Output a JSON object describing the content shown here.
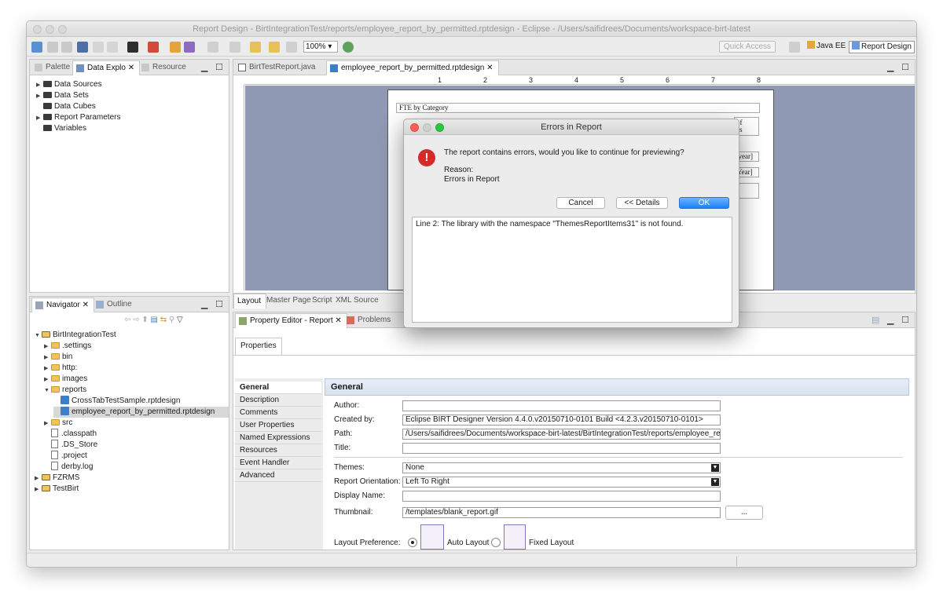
{
  "window": {
    "title": "Report Design - BirtIntegrationTest/reports/employee_report_by_permitted.rptdesign - Eclipse - /Users/saifidrees/Documents/workspace-birt-latest"
  },
  "toolbar": {
    "zoom": "100%",
    "quick_access": "Quick Access",
    "perspective_java": "Java EE",
    "perspective_report": "Report Design"
  },
  "left_top": {
    "tabs": [
      "Palette",
      "Data Explo",
      "Resource"
    ],
    "items": [
      "Data Sources",
      "Data Sets",
      "Data Cubes",
      "Report Parameters",
      "Variables"
    ]
  },
  "navigator": {
    "tabs": [
      "Navigator",
      "Outline"
    ],
    "tree": [
      {
        "label": "BirtIntegrationTest",
        "indent": 0,
        "kind": "proj",
        "open": true
      },
      {
        "label": ".settings",
        "indent": 1,
        "kind": "folder"
      },
      {
        "label": "bin",
        "indent": 1,
        "kind": "folder"
      },
      {
        "label": "http:",
        "indent": 1,
        "kind": "folder"
      },
      {
        "label": "images",
        "indent": 1,
        "kind": "folder"
      },
      {
        "label": "reports",
        "indent": 1,
        "kind": "folder",
        "open": true
      },
      {
        "label": "CrossTabTestSample.rptdesign",
        "indent": 2,
        "kind": "rpt"
      },
      {
        "label": "employee_report_by_permitted.rptdesign",
        "indent": 2,
        "kind": "rpt",
        "selected": true
      },
      {
        "label": "src",
        "indent": 1,
        "kind": "folder"
      },
      {
        "label": ".classpath",
        "indent": 1,
        "kind": "file"
      },
      {
        "label": ".DS_Store",
        "indent": 1,
        "kind": "file"
      },
      {
        "label": ".project",
        "indent": 1,
        "kind": "file"
      },
      {
        "label": "derby.log",
        "indent": 1,
        "kind": "file"
      },
      {
        "label": "FZRMS",
        "indent": 0,
        "kind": "proj"
      },
      {
        "label": "TestBirt",
        "indent": 0,
        "kind": "proj"
      }
    ]
  },
  "editor": {
    "tabs": [
      "BirtTestReport.java",
      "employee_report_by_permitted.rptdesign"
    ],
    "bottom_tabs": [
      "Layout",
      "Master Page",
      "Script",
      "XML Source"
    ],
    "ruler_numbers": [
      "1",
      "2",
      "3",
      "4",
      "5",
      "6",
      "7",
      "8"
    ],
    "report_title_cell": "FTE by Category",
    "cell_texts": [
      "of",
      "es",
      "_year]",
      "rYear]"
    ]
  },
  "dialog": {
    "title": "Errors in Report",
    "message": "The report contains errors, would you like to continue for previewing?",
    "reason_label": "Reason:",
    "reason": "Errors in Report",
    "cancel": "Cancel",
    "details": "<< Details",
    "ok": "OK",
    "detail_text": "Line 2: The library with the namespace \"ThemesReportItems31\" is not found."
  },
  "property_editor": {
    "tabs": [
      "Property Editor - Report",
      "Problems"
    ],
    "sub_tab": "Properties",
    "categories": [
      "General",
      "Description",
      "Comments",
      "User Properties",
      "Named Expressions",
      "Resources",
      "Event Handler",
      "Advanced"
    ],
    "section_title": "General",
    "author_label": "Author:",
    "author": "",
    "created_by_label": "Created by:",
    "created_by": "Eclipse BIRT Designer Version 4.4.0.v20150710-0101 Build <4.2.3.v20150710-0101>",
    "path_label": "Path:",
    "path": "/Users/saifidrees/Documents/workspace-birt-latest/BirtIntegrationTest/reports/employee_report",
    "title_label": "Title:",
    "title": "",
    "themes_label": "Themes:",
    "themes": "None",
    "orientation_label": "Report Orientation:",
    "orientation": "Left To Right",
    "display_name_label": "Display Name:",
    "display_name": "",
    "thumbnail_label": "Thumbnail:",
    "thumbnail": "/templates/blank_report.gif",
    "browse": "...",
    "layout_pref_label": "Layout Preference:",
    "auto_layout": "Auto Layout",
    "fixed_layout": "Fixed Layout"
  },
  "colors": {
    "canvas": "#8f99b3",
    "ok_button": "#1a82fb",
    "error_icon": "#d62a2a"
  }
}
